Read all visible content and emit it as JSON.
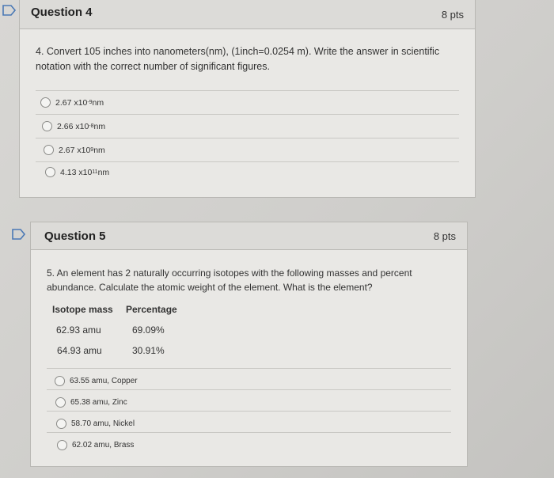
{
  "question4": {
    "title": "Question 4",
    "points": "8 pts",
    "text": "4. Convert 105 inches into nanometers(nm), (1inch=0.0254 m). Write the answer in scientific notation with the correct number of significant figures.",
    "options": [
      {
        "mantissa": "2.67 x10",
        "exp": "-9",
        "unit": " nm"
      },
      {
        "mantissa": "2.66 x10",
        "exp": "-8",
        "unit": " nm"
      },
      {
        "mantissa": "2.67 x10",
        "exp": "9",
        "unit": " nm"
      },
      {
        "mantissa": "4.13 x10",
        "exp": "11",
        "unit": " nm"
      }
    ]
  },
  "question5": {
    "title": "Question 5",
    "points": "8 pts",
    "text": "5. An element has 2 naturally occurring isotopes with the following masses and percent abundance. Calculate the atomic weight of the element. What is the element?",
    "table": {
      "headers": [
        "Isotope mass",
        "Percentage"
      ],
      "rows": [
        [
          "62.93 amu",
          "69.09%"
        ],
        [
          "64.93 amu",
          "30.91%"
        ]
      ]
    },
    "options": [
      "63.55 amu, Copper",
      "65.38 amu, Zinc",
      "58.70 amu, Nickel",
      "62.02 amu, Brass"
    ]
  },
  "icons": {
    "flag": "bookmark-flag-icon",
    "radio": "radio-button-icon"
  },
  "colors": {
    "flag": "#4a78b5",
    "header_bg": "#dcdbd8",
    "box_bg": "#e9e8e5"
  }
}
